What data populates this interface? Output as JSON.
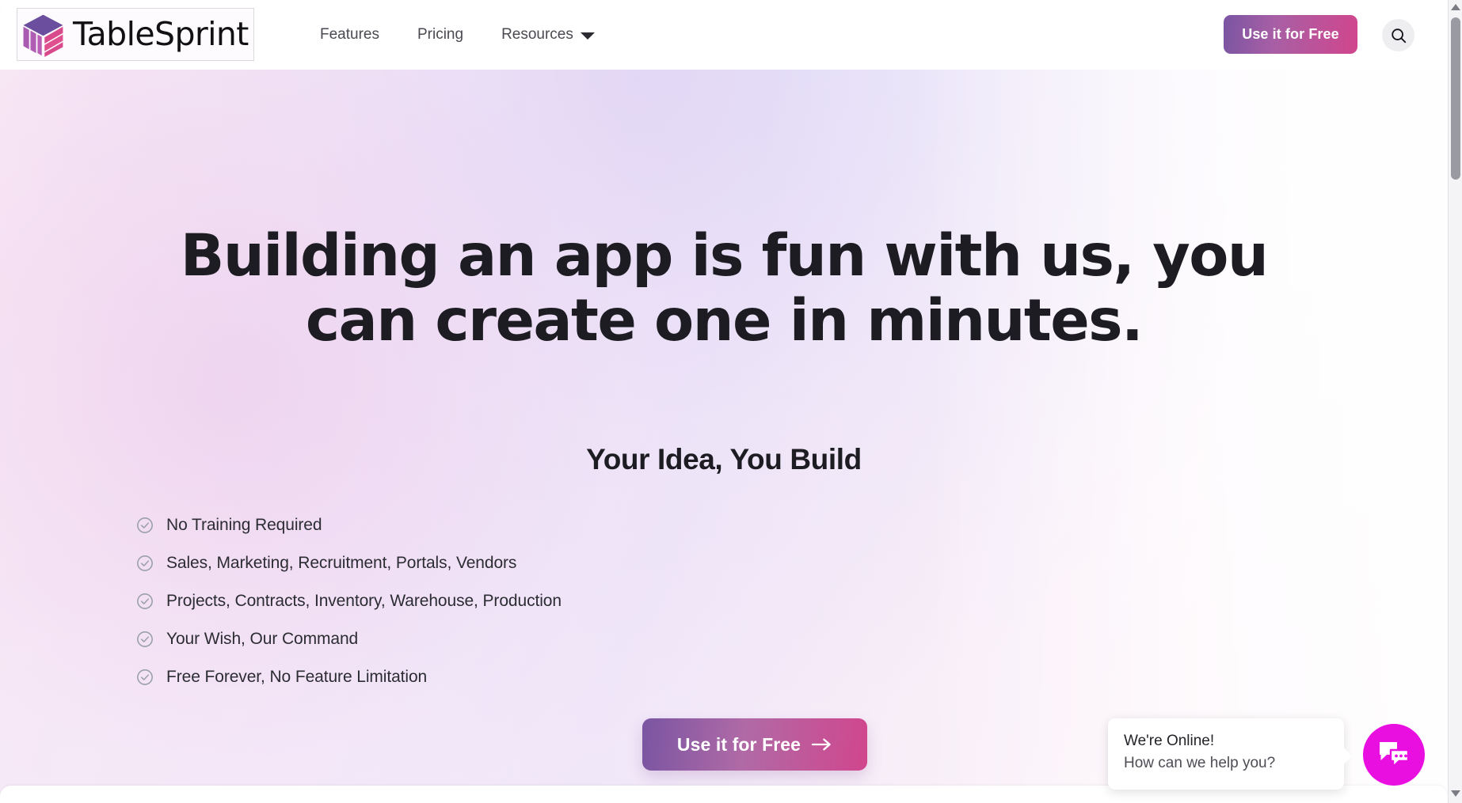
{
  "header": {
    "logo_text": "TableSprint",
    "logo_icon": "cube-logo-icon",
    "nav": [
      {
        "label": "Features",
        "has_caret": false
      },
      {
        "label": "Pricing",
        "has_caret": false
      },
      {
        "label": "Resources",
        "has_caret": true
      }
    ],
    "cta_label": "Use it for Free",
    "search_icon": "search-icon"
  },
  "hero": {
    "headline": "Building an app is fun with us, you can create one in minutes.",
    "subheadline": "Your Idea, You Build",
    "features": [
      "No Training Required",
      "Sales, Marketing, Recruitment, Portals, Vendors",
      "Projects, Contracts, Inventory, Warehouse, Production",
      "Your Wish, Our Command",
      "Free Forever, No Feature Limitation"
    ],
    "cta_label": "Use it for Free",
    "cta_arrow_icon": "arrow-right-icon"
  },
  "chat": {
    "title": "We're Online!",
    "subtitle": "How can we help you?",
    "fab_icon": "chat-bubbles-icon"
  },
  "colors": {
    "brand_purple": "#7a55a2",
    "brand_pink": "#d1468d",
    "chat_magenta": "#e90fe0",
    "heading_text": "#1c1c22",
    "body_text": "#2c2c33",
    "nav_text": "#4a4a52",
    "check_gray": "#9aa0aa"
  }
}
